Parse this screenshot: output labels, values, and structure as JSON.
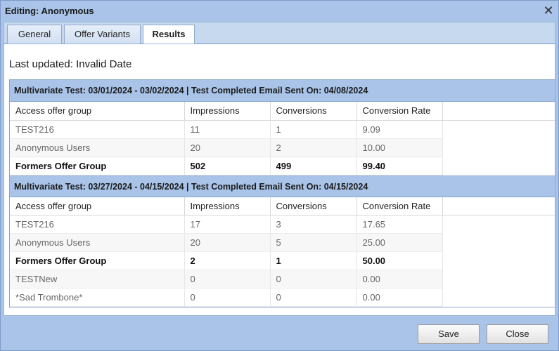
{
  "dialog": {
    "title": "Editing: Anonymous",
    "close_glyph": "✕"
  },
  "tabs": [
    {
      "label": "General",
      "active": false
    },
    {
      "label": "Offer Variants",
      "active": false
    },
    {
      "label": "Results",
      "active": true
    }
  ],
  "last_updated": "Last updated: Invalid Date",
  "columns": [
    "Access offer group",
    "Impressions",
    "Conversions",
    "Conversion Rate"
  ],
  "tests": [
    {
      "header": "Multivariate Test: 03/01/2024 - 03/02/2024 | Test Completed Email Sent On: 04/08/2024",
      "rows": [
        {
          "group": "TEST216",
          "impressions": "11",
          "conversions": "1",
          "rate": "9.09",
          "bold": false
        },
        {
          "group": "Anonymous Users",
          "impressions": "20",
          "conversions": "2",
          "rate": "10.00",
          "bold": false
        },
        {
          "group": "Formers Offer Group",
          "impressions": "502",
          "conversions": "499",
          "rate": "99.40",
          "bold": true
        }
      ]
    },
    {
      "header": "Multivariate Test: 03/27/2024 - 04/15/2024 | Test Completed Email Sent On: 04/15/2024",
      "rows": [
        {
          "group": "TEST216",
          "impressions": "17",
          "conversions": "3",
          "rate": "17.65",
          "bold": false
        },
        {
          "group": "Anonymous Users",
          "impressions": "20",
          "conversions": "5",
          "rate": "25.00",
          "bold": false
        },
        {
          "group": "Formers Offer Group",
          "impressions": "2",
          "conversions": "1",
          "rate": "50.00",
          "bold": true
        },
        {
          "group": "TESTNew",
          "impressions": "0",
          "conversions": "0",
          "rate": "0.00",
          "bold": false
        },
        {
          "group": "*Sad Trombone*",
          "impressions": "0",
          "conversions": "0",
          "rate": "0.00",
          "bold": false
        }
      ]
    }
  ],
  "footer": {
    "save_label": "Save",
    "close_label": "Close"
  }
}
